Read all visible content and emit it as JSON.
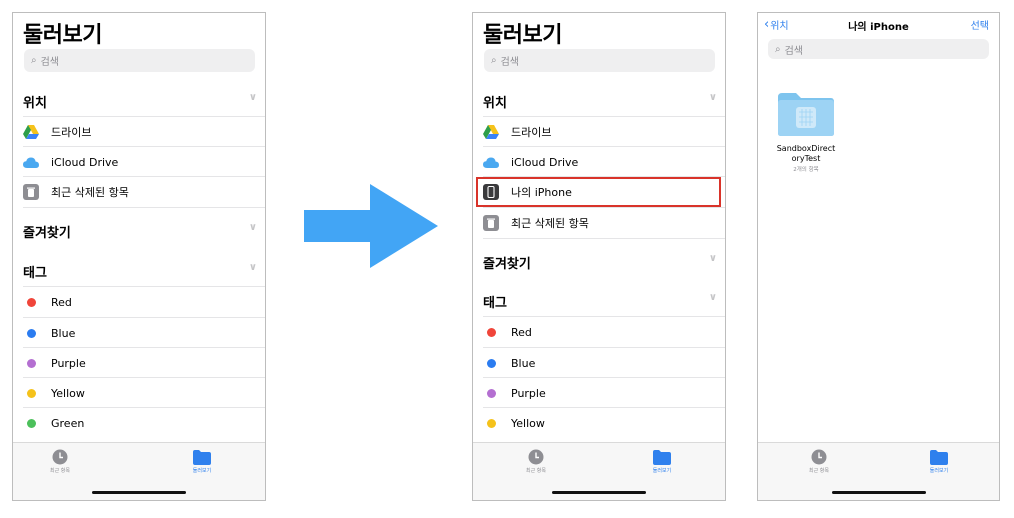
{
  "files_browse": {
    "title": "둘러보기",
    "search_placeholder": "검색",
    "locations_header": "위치",
    "favorites_header": "즐겨찾기",
    "tags_header": "태그",
    "drive": "드라이브",
    "icloud": "iCloud Drive",
    "my_iphone": "나의 iPhone",
    "recently_deleted": "최근 삭제된 항목",
    "tags": [
      {
        "name": "Red",
        "color": "#f0453a"
      },
      {
        "name": "Blue",
        "color": "#2b7cf0"
      },
      {
        "name": "Purple",
        "color": "#b46fd1"
      },
      {
        "name": "Yellow",
        "color": "#f5c21b"
      },
      {
        "name": "Green",
        "color": "#4cc05b"
      }
    ],
    "tab_recent": "최근 항목",
    "tab_browse": "둘러보기"
  },
  "iphone_folder": {
    "back_label": "위치",
    "title": "나의 iPhone",
    "select_label": "선택",
    "search_placeholder": "검색",
    "folder_name_line1": "SandboxDirect",
    "folder_name_line2": "oryTest",
    "folder_count": "2개의 항목"
  },
  "colors": {
    "accent": "#2f80ed",
    "highlight_box": "#d9332a",
    "arrow": "#42a5f5",
    "folder": "#8ecdf1"
  }
}
